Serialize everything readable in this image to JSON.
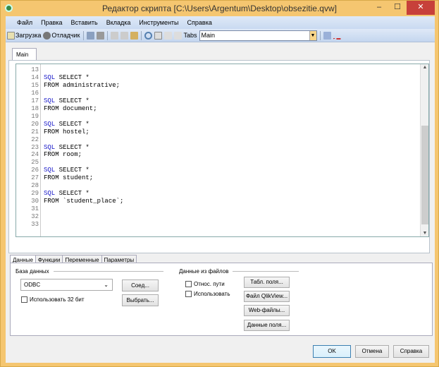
{
  "window": {
    "title": "Редактор скрипта [C:\\Users\\Argentum\\Desktop\\obsezitie.qvw]",
    "minimize": "–",
    "maximize": "☐",
    "close": "✕"
  },
  "menu": [
    "Файл",
    "Правка",
    "Вставить",
    "Вкладка",
    "Инструменты",
    "Справка"
  ],
  "toolbar": {
    "load": "Загрузка",
    "debug": "Отладчик",
    "tabs_label": "Tabs",
    "tab_select": "Main"
  },
  "editor_tab": "Main",
  "code": {
    "lines": [
      {
        "n": "13",
        "t": ""
      },
      {
        "n": "14",
        "kw": "SQL",
        "t": " SELECT *"
      },
      {
        "n": "15",
        "t": "FROM administrative;"
      },
      {
        "n": "16",
        "t": ""
      },
      {
        "n": "17",
        "kw": "SQL",
        "t": " SELECT *"
      },
      {
        "n": "18",
        "t": "FROM document;"
      },
      {
        "n": "19",
        "t": ""
      },
      {
        "n": "20",
        "kw": "SQL",
        "t": " SELECT *"
      },
      {
        "n": "21",
        "t": "FROM hostel;"
      },
      {
        "n": "22",
        "t": ""
      },
      {
        "n": "23",
        "kw": "SQL",
        "t": " SELECT *"
      },
      {
        "n": "24",
        "t": "FROM room;"
      },
      {
        "n": "25",
        "t": ""
      },
      {
        "n": "26",
        "kw": "SQL",
        "t": " SELECT *"
      },
      {
        "n": "27",
        "t": "FROM student;"
      },
      {
        "n": "28",
        "t": ""
      },
      {
        "n": "29",
        "kw": "SQL",
        "t": " SELECT *"
      },
      {
        "n": "30",
        "t": "FROM `student_place`;"
      },
      {
        "n": "31",
        "t": ""
      },
      {
        "n": "32",
        "t": ""
      },
      {
        "n": "33",
        "t": ""
      }
    ]
  },
  "bottom_tabs": [
    "Данные",
    "Функции",
    "Переменные",
    "Параметры"
  ],
  "data_panel": {
    "db_group": "База данных",
    "db_value": "ODBC",
    "connect": "Соед...",
    "use32": "Использовать 32 бит",
    "select": "Выбрать...",
    "files_group": "Данные из файлов",
    "relative": "Относ. пути",
    "use": "Использовать",
    "table_files": "Табл. поля...",
    "qlik_file": "Файл QlikView...",
    "web_files": "Web-файлы...",
    "field_data": "Данные поля..."
  },
  "dialog": {
    "ok": "OK",
    "cancel": "Отмена",
    "help": "Справка"
  }
}
